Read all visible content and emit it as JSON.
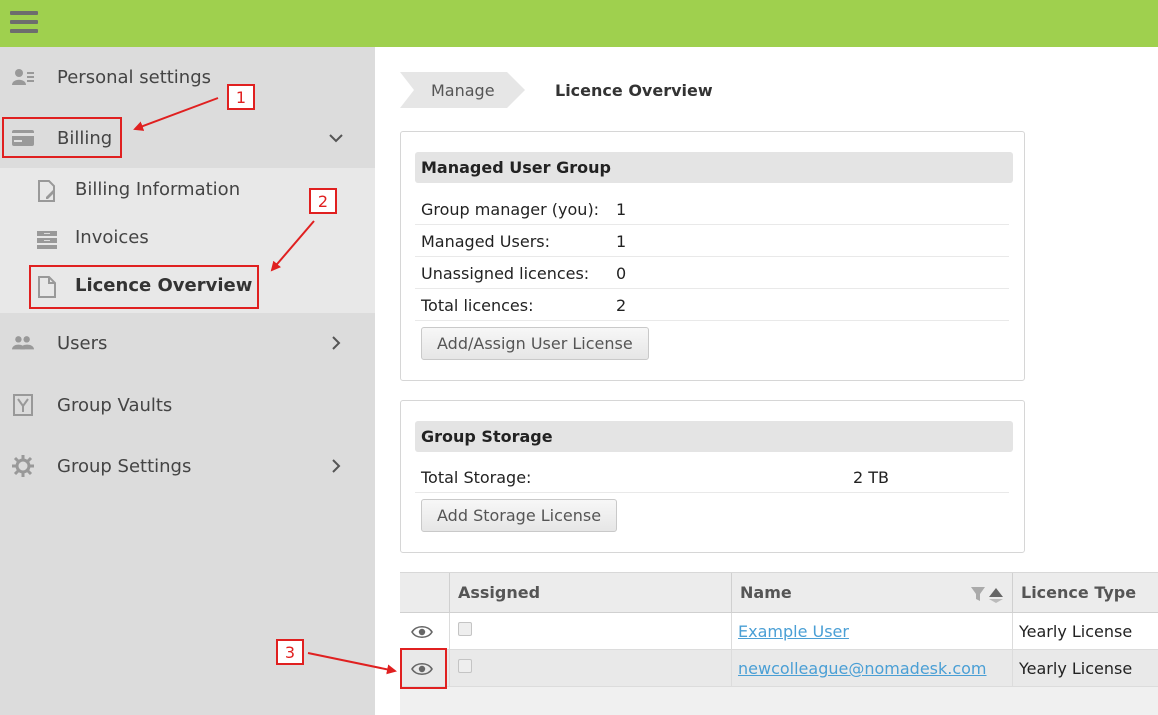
{
  "sidebar": {
    "personal_settings": "Personal settings",
    "billing": "Billing",
    "billing_information": "Billing Information",
    "invoices": "Invoices",
    "licence_overview": "Licence Overview",
    "users": "Users",
    "group_vaults": "Group Vaults",
    "group_settings": "Group Settings"
  },
  "callouts": [
    "1",
    "2",
    "3"
  ],
  "breadcrumb": {
    "parent": "Manage",
    "current": "Licence Overview"
  },
  "managed_group": {
    "title": "Managed User Group",
    "rows": [
      {
        "label": "Group manager (you):",
        "value": "1"
      },
      {
        "label": "Managed Users:",
        "value": "1"
      },
      {
        "label": "Unassigned licences:",
        "value": "0"
      },
      {
        "label": "Total licences:",
        "value": "2"
      }
    ],
    "button": "Add/Assign User License"
  },
  "storage": {
    "title": "Group Storage",
    "label": "Total Storage:",
    "value": "2 TB",
    "button": "Add Storage License"
  },
  "grid": {
    "columns": [
      "Assigned",
      "Name",
      "Licence Type"
    ],
    "rows": [
      {
        "name": "Example User",
        "type": "Yearly License"
      },
      {
        "name": "newcolleague@nomadesk.com",
        "type": "Yearly License"
      }
    ]
  },
  "colors": {
    "topbar": "#9fd04e",
    "highlight": "#e02020",
    "link": "#4a9fd5"
  },
  "icons": [
    "menu-icon",
    "person-settings-icon",
    "credit-card-icon",
    "document-edit-icon",
    "invoices-icon",
    "document-icon",
    "users-icon",
    "vault-icon",
    "gear-icon",
    "chevron-down-icon",
    "chevron-right-icon",
    "filter-icon",
    "sort-up-icon",
    "eye-icon"
  ]
}
